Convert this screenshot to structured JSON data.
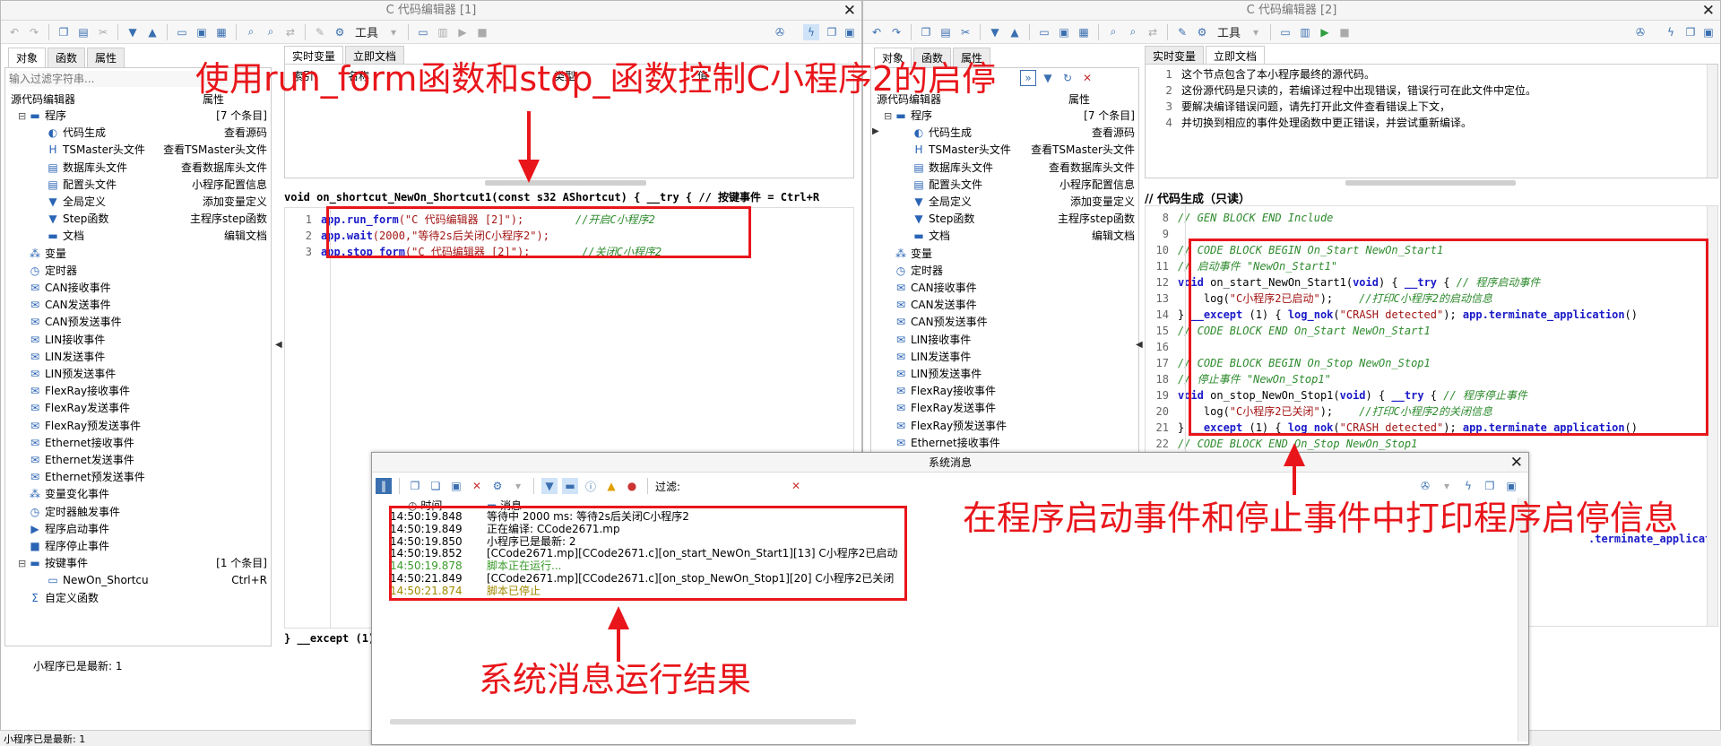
{
  "left_editor": {
    "title": "C 代码编辑器 [1]",
    "tools_label": "工具",
    "side_tabs": [
      "对象",
      "函数",
      "属性"
    ],
    "filter_placeholder": "输入过滤字符串...",
    "tree_col_header": "属性",
    "tree_root": "源代码编辑器",
    "tree_items": [
      {
        "label": "程序",
        "value": "[7 个条目]",
        "icon": "program-icon",
        "indent": 1,
        "toggle": "−"
      },
      {
        "label": "代码生成",
        "value": "查看源码",
        "icon": "code-gen-icon",
        "indent": 2
      },
      {
        "label": "TSMaster头文件",
        "value": "查看TSMaster头文件",
        "icon": "header-icon",
        "indent": 2
      },
      {
        "label": "数据库头文件",
        "value": "查看数据库头文件",
        "icon": "database-icon",
        "indent": 2
      },
      {
        "label": "配置头文件",
        "value": "小程序配置信息",
        "icon": "config-icon",
        "indent": 2
      },
      {
        "label": "全局定义",
        "value": "添加变量定义",
        "icon": "global-icon",
        "indent": 2
      },
      {
        "label": "Step函数",
        "value": "主程序step函数",
        "icon": "step-icon",
        "indent": 2
      },
      {
        "label": "文档",
        "value": "编辑文档",
        "icon": "doc-icon",
        "indent": 2
      },
      {
        "label": "变量",
        "value": "",
        "icon": "variable-icon",
        "indent": 1
      },
      {
        "label": "定时器",
        "value": "",
        "icon": "timer-icon",
        "indent": 1
      },
      {
        "label": "CAN接收事件",
        "value": "",
        "icon": "can-rx-icon",
        "indent": 1
      },
      {
        "label": "CAN发送事件",
        "value": "",
        "icon": "can-tx-icon",
        "indent": 1
      },
      {
        "label": "CAN预发送事件",
        "value": "",
        "icon": "can-pretx-icon",
        "indent": 1
      },
      {
        "label": "LIN接收事件",
        "value": "",
        "icon": "lin-rx-icon",
        "indent": 1
      },
      {
        "label": "LIN发送事件",
        "value": "",
        "icon": "lin-tx-icon",
        "indent": 1
      },
      {
        "label": "LIN预发送事件",
        "value": "",
        "icon": "lin-pretx-icon",
        "indent": 1
      },
      {
        "label": "FlexRay接收事件",
        "value": "",
        "icon": "flexray-rx-icon",
        "indent": 1
      },
      {
        "label": "FlexRay发送事件",
        "value": "",
        "icon": "flexray-tx-icon",
        "indent": 1
      },
      {
        "label": "FlexRay预发送事件",
        "value": "",
        "icon": "flexray-pretx-icon",
        "indent": 1
      },
      {
        "label": "Ethernet接收事件",
        "value": "",
        "icon": "eth-rx-icon",
        "indent": 1
      },
      {
        "label": "Ethernet发送事件",
        "value": "",
        "icon": "eth-tx-icon",
        "indent": 1
      },
      {
        "label": "Ethernet预发送事件",
        "value": "",
        "icon": "eth-pretx-icon",
        "indent": 1
      },
      {
        "label": "变量变化事件",
        "value": "",
        "icon": "var-change-icon",
        "indent": 1
      },
      {
        "label": "定时器触发事件",
        "value": "",
        "icon": "timer-trigger-icon",
        "indent": 1
      },
      {
        "label": "程序启动事件",
        "value": "",
        "icon": "start-event-icon",
        "indent": 1
      },
      {
        "label": "程序停止事件",
        "value": "",
        "icon": "stop-event-icon",
        "indent": 1
      },
      {
        "label": "按键事件",
        "value": "[1 个条目]",
        "icon": "key-event-icon",
        "indent": 1,
        "toggle": "−"
      },
      {
        "label": "NewOn_Shortcu",
        "value": "Ctrl+R",
        "icon": "shortcut-icon",
        "indent": 2
      },
      {
        "label": "自定义函数",
        "value": "",
        "icon": "sigma-icon",
        "indent": 1
      }
    ],
    "right_tabs": [
      "实时变量",
      "立即文档"
    ],
    "var_table_headers": [
      "索引",
      "名称",
      "类型",
      "值"
    ],
    "code_header": "void on_shortcut_NewOn_Shortcut1(const s32 AShortcut) { __try { // 按键事件 = Ctrl+R",
    "code_lines": [
      {
        "n": "1",
        "fn": "app.run_form",
        "args": "(\"C 代码编辑器 [2]\");",
        "comment": "//开启C小程序2"
      },
      {
        "n": "2",
        "fn": "app.wait",
        "args": "(2000,\"等待2s后关闭C小程序2\");",
        "comment": ""
      },
      {
        "n": "3",
        "fn": "app.stop_form",
        "args": "(\"C 代码编辑器 [2]\");",
        "comment": "//关闭C小程序2"
      }
    ],
    "code_footer": "} __except (1)",
    "status_text": "小程序已是最新: 1"
  },
  "right_editor": {
    "title": "C 代码编辑器 [2]",
    "tools_label": "工具",
    "side_tabs": [
      "对象",
      "函数",
      "属性"
    ],
    "tree_col_header": "属性",
    "tree_root": "源代码编辑器",
    "tree_items": [
      {
        "label": "程序",
        "value": "[7 个条目]",
        "icon": "program-icon",
        "indent": 1,
        "toggle": "−"
      },
      {
        "label": "代码生成",
        "value": "查看源码",
        "icon": "code-gen-icon",
        "indent": 2
      },
      {
        "label": "TSMaster头文件",
        "value": "查看TSMaster头文件",
        "icon": "header-icon",
        "indent": 2
      },
      {
        "label": "数据库头文件",
        "value": "查看数据库头文件",
        "icon": "database-icon",
        "indent": 2
      },
      {
        "label": "配置头文件",
        "value": "小程序配置信息",
        "icon": "config-icon",
        "indent": 2
      },
      {
        "label": "全局定义",
        "value": "添加变量定义",
        "icon": "global-icon",
        "indent": 2
      },
      {
        "label": "Step函数",
        "value": "主程序step函数",
        "icon": "step-icon",
        "indent": 2
      },
      {
        "label": "文档",
        "value": "编辑文档",
        "icon": "doc-icon",
        "indent": 2
      },
      {
        "label": "变量",
        "value": "",
        "icon": "variable-icon",
        "indent": 1
      },
      {
        "label": "定时器",
        "value": "",
        "icon": "timer-icon",
        "indent": 1
      },
      {
        "label": "CAN接收事件",
        "value": "",
        "icon": "can-rx-icon",
        "indent": 1
      },
      {
        "label": "CAN发送事件",
        "value": "",
        "icon": "can-tx-icon",
        "indent": 1
      },
      {
        "label": "CAN预发送事件",
        "value": "",
        "icon": "can-pretx-icon",
        "indent": 1
      },
      {
        "label": "LIN接收事件",
        "value": "",
        "icon": "lin-rx-icon",
        "indent": 1
      },
      {
        "label": "LIN发送事件",
        "value": "",
        "icon": "lin-tx-icon",
        "indent": 1
      },
      {
        "label": "LIN预发送事件",
        "value": "",
        "icon": "lin-pretx-icon",
        "indent": 1
      },
      {
        "label": "FlexRay接收事件",
        "value": "",
        "icon": "flexray-rx-icon",
        "indent": 1
      },
      {
        "label": "FlexRay发送事件",
        "value": "",
        "icon": "flexray-tx-icon",
        "indent": 1
      },
      {
        "label": "FlexRay预发送事件",
        "value": "",
        "icon": "flexray-pretx-icon",
        "indent": 1
      },
      {
        "label": "Ethernet接收事件",
        "value": "",
        "icon": "eth-rx-icon",
        "indent": 1
      }
    ],
    "right_tabs": [
      "实时变量",
      "立即文档"
    ],
    "doc_lines": [
      {
        "n": "1",
        "text": "这个节点包含了本小程序最终的源代码。"
      },
      {
        "n": "2",
        "text": "这份源代码是只读的，若编译过程中出现错误，错误行可在此文件中定位。"
      },
      {
        "n": "3",
        "text": "要解决编译错误问题，请先打开此文件查看错误上下文，"
      },
      {
        "n": "4",
        "text": "并切换到相应的事件处理函数中更正错误，并尝试重新编译。"
      }
    ],
    "code_title": "// 代码生成（只读）",
    "code_lines": [
      {
        "n": "8",
        "parts": [
          [
            "cm",
            "// GEN BLOCK END Include"
          ]
        ]
      },
      {
        "n": "9",
        "parts": []
      },
      {
        "n": "10",
        "parts": [
          [
            "cm",
            "// CODE BLOCK BEGIN On_Start NewOn_Start1"
          ]
        ]
      },
      {
        "n": "11",
        "parts": [
          [
            "cm",
            "// 启动事件 \"NewOn_Start1\""
          ]
        ]
      },
      {
        "n": "12",
        "parts": [
          [
            "kw",
            "void"
          ],
          [
            "fn",
            " on_start_NewOn_Start1("
          ],
          [
            "kw",
            "void"
          ],
          [
            "fn",
            ") { "
          ],
          [
            "kw",
            "__try"
          ],
          [
            "fn",
            " { "
          ],
          [
            "cm",
            "// 程序启动事件"
          ]
        ]
      },
      {
        "n": "13",
        "parts": [
          [
            "fn",
            "    log("
          ],
          [
            "str",
            "\"C小程序2已启动\""
          ],
          [
            "fn",
            ");    "
          ],
          [
            "cm",
            "//打印C小程序2的启动信息"
          ]
        ]
      },
      {
        "n": "14",
        "parts": [
          [
            "fn",
            "} "
          ],
          [
            "kw",
            "__except"
          ],
          [
            "fn",
            " (1) { "
          ],
          [
            "kw",
            "log_nok"
          ],
          [
            "fn",
            "("
          ],
          [
            "str",
            "\"CRASH detected\""
          ],
          [
            "fn",
            "); "
          ],
          [
            "kw",
            "app.terminate_application"
          ],
          [
            "fn",
            "()"
          ]
        ]
      },
      {
        "n": "15",
        "parts": [
          [
            "cm",
            "// CODE BLOCK END On_Start NewOn_Start1"
          ]
        ]
      },
      {
        "n": "16",
        "parts": []
      },
      {
        "n": "17",
        "parts": [
          [
            "cm",
            "// CODE BLOCK BEGIN On_Stop NewOn_Stop1"
          ]
        ]
      },
      {
        "n": "18",
        "parts": [
          [
            "cm",
            "// 停止事件 \"NewOn_Stop1\""
          ]
        ]
      },
      {
        "n": "19",
        "parts": [
          [
            "kw",
            "void"
          ],
          [
            "fn",
            " on_stop_NewOn_Stop1("
          ],
          [
            "kw",
            "void"
          ],
          [
            "fn",
            ") { "
          ],
          [
            "kw",
            "__try"
          ],
          [
            "fn",
            " { "
          ],
          [
            "cm",
            "// 程序停止事件"
          ]
        ]
      },
      {
        "n": "20",
        "parts": [
          [
            "fn",
            "    log("
          ],
          [
            "str",
            "\"C小程序2已关闭\""
          ],
          [
            "fn",
            ");    "
          ],
          [
            "cm",
            "//打印C小程序2的关闭信息"
          ]
        ]
      },
      {
        "n": "21",
        "parts": [
          [
            "fn",
            "} "
          ],
          [
            "kw",
            "__except"
          ],
          [
            "fn",
            " (1) { "
          ],
          [
            "kw",
            "log_nok"
          ],
          [
            "fn",
            "("
          ],
          [
            "str",
            "\"CRASH detected\""
          ],
          [
            "fn",
            "); "
          ],
          [
            "kw",
            "app.terminate_application"
          ],
          [
            "fn",
            "()"
          ]
        ]
      },
      {
        "n": "22",
        "parts": [
          [
            "cm",
            "// CODE BLOCK END On_Stop NewOn_Stop1"
          ]
        ]
      }
    ],
    "tail_text": ".terminate_application()"
  },
  "system_messages": {
    "title": "系统消息",
    "filter_label": "过滤:",
    "col_time": "时间",
    "col_msg": "消息",
    "rows": [
      {
        "time": "14:50:19.848",
        "msg": "等待中 2000 ms: 等待2s后关闭C小程序2",
        "color": "#000000"
      },
      {
        "time": "14:50:19.849",
        "msg": "正在编译: CCode2671.mp",
        "color": "#000000"
      },
      {
        "time": "14:50:19.850",
        "msg": "小程序已是最新: 2",
        "color": "#000000"
      },
      {
        "time": "14:50:19.852",
        "msg": "[CCode2671.mp][CCode2671.c][on_start_NewOn_Start1][13] C小程序2已启动",
        "color": "#000000"
      },
      {
        "time": "14:50:19.878",
        "msg": "脚本正在运行...",
        "color": "#3a9a2a"
      },
      {
        "time": "14:50:21.849",
        "msg": "[CCode2671.mp][CCode2671.c][on_stop_NewOn_Stop1][20] C小程序2已关闭",
        "color": "#000000"
      },
      {
        "time": "14:50:21.874",
        "msg": "脚本已停止",
        "color": "#a08a00"
      }
    ]
  },
  "annotations": {
    "top": "使用run_form函数和stop_函数控制C小程序2的启停",
    "right": "在程序启动事件和停止事件中打印程序启停信息",
    "bottom": "系统消息运行结果"
  },
  "statusbar": {
    "text": "小程序已是最新: 1"
  },
  "colors": {
    "annotation": "#e8161b",
    "keyword": "#1a1ac8",
    "comment": "#2e8b2e",
    "string": "#a31515"
  }
}
